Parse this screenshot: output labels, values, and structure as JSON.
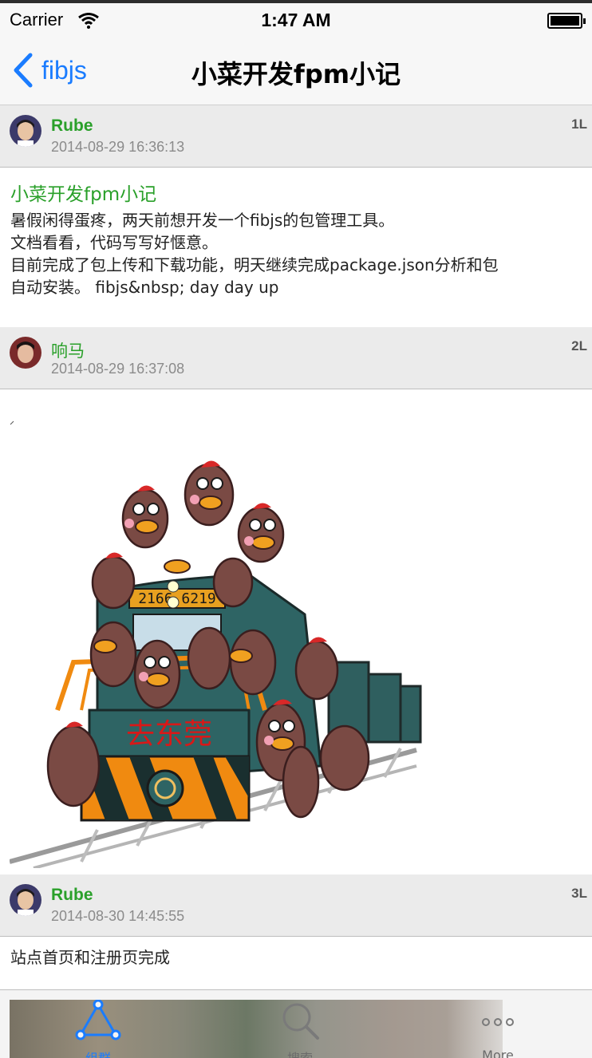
{
  "status_bar": {
    "carrier": "Carrier",
    "time": "1:47 AM"
  },
  "nav": {
    "back_label": "fibjs",
    "title": "小菜开发fpm小记"
  },
  "posts": [
    {
      "author": "Rube",
      "timestamp": "2014-08-29 16:36:13",
      "floor": "1L",
      "title": "小菜开发fpm小记",
      "lines": [
        "暑假闲得蛋疼，两天前想开发一个fibjs的包管理工具。",
        "文档看看，代码写写好惬意。",
        "目前完成了包上传和下载功能，明天继续完成package.json分析和包",
        "自动安装。 fibjs&nbsp; day day up"
      ]
    },
    {
      "author": "响马",
      "timestamp": "2014-08-29 16:37:08",
      "floor": "2L",
      "image_text": "去东莞",
      "train_number": "2166 6219"
    },
    {
      "author": "Rube",
      "timestamp": "2014-08-30 14:45:55",
      "floor": "3L",
      "lines": [
        "站点首页和注册页完成"
      ]
    }
  ],
  "tabbar": {
    "tabs": [
      {
        "label": "组群",
        "icon": "triangle-nodes-icon",
        "active": true
      },
      {
        "label": "搜索",
        "icon": "search-icon",
        "active": false
      },
      {
        "label": "More",
        "icon": "more-dots-icon",
        "active": false
      }
    ]
  },
  "colors": {
    "accent": "#1a7cff",
    "author": "#2aa02a",
    "header_bg": "#ebebeb"
  }
}
